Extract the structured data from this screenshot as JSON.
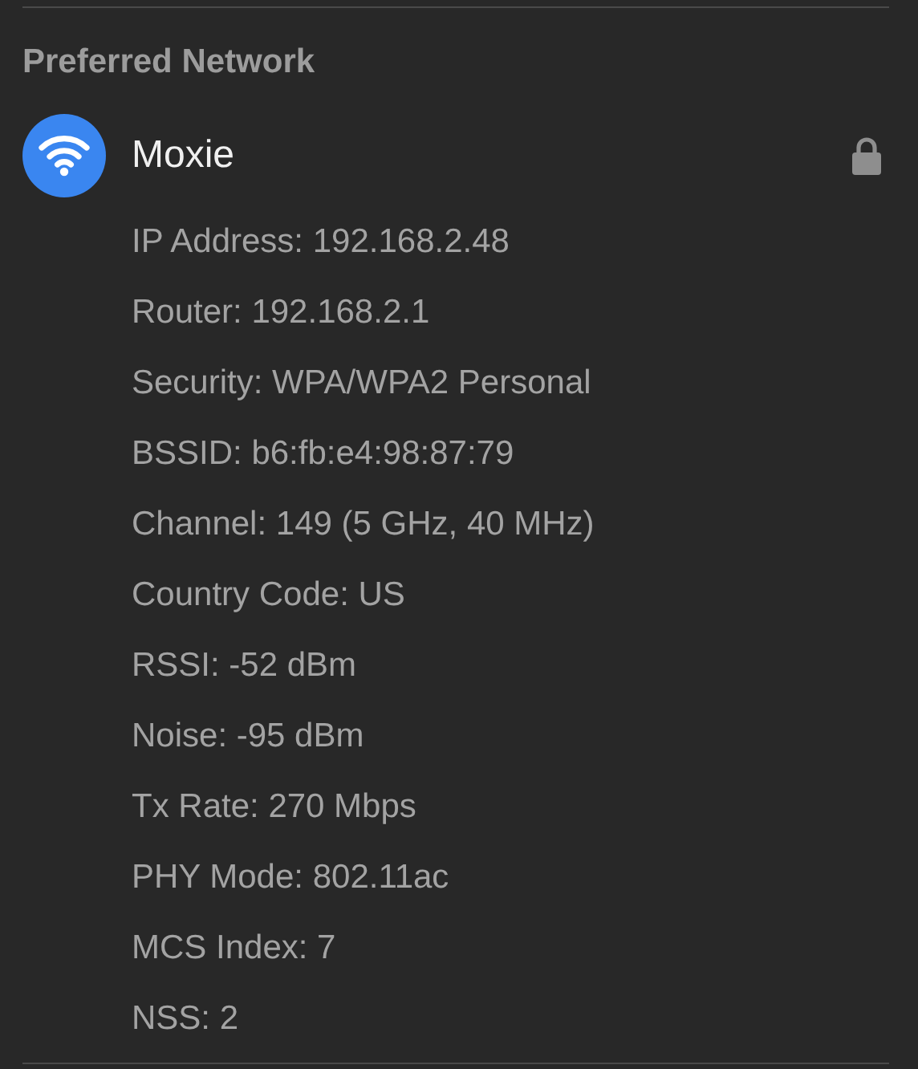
{
  "section_title": "Preferred Network",
  "network": {
    "name": "Moxie",
    "locked": true
  },
  "details": [
    "IP Address: 192.168.2.48",
    "Router: 192.168.2.1",
    "Security: WPA/WPA2 Personal",
    "BSSID: b6:fb:e4:98:87:79",
    "Channel: 149 (5 GHz, 40 MHz)",
    "Country Code: US",
    "RSSI: -52 dBm",
    "Noise: -95 dBm",
    "Tx Rate: 270 Mbps",
    "PHY Mode: 802.11ac",
    "MCS Index: 7",
    "NSS: 2"
  ]
}
